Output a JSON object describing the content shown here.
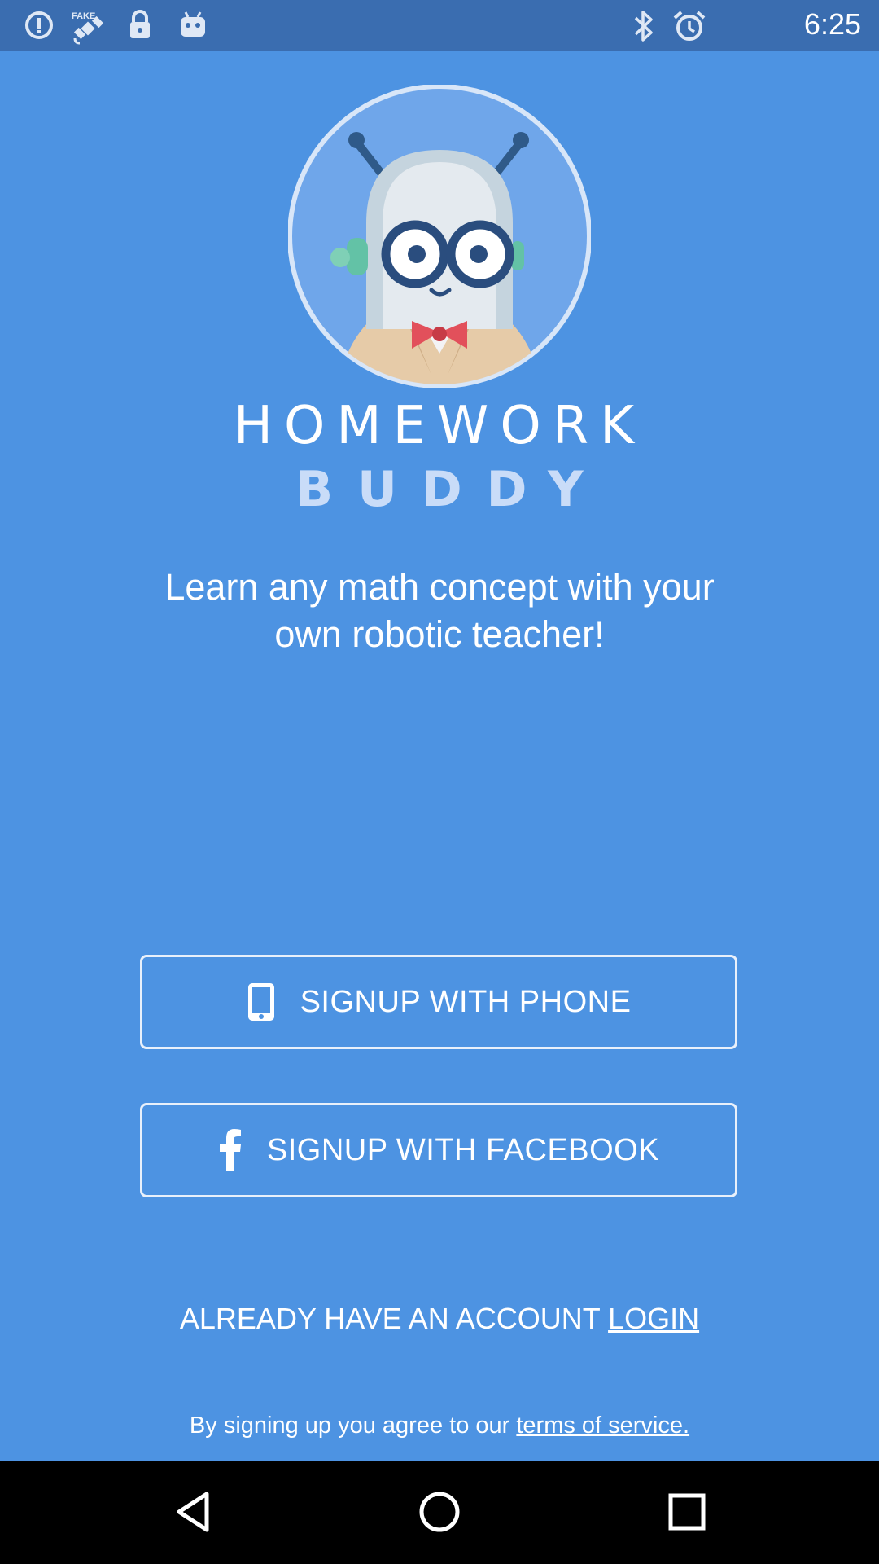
{
  "status_bar": {
    "time": "6:25",
    "icons": [
      "alert-circle-icon",
      "fake-gps-satellite-icon",
      "lock-icon",
      "android-icon",
      "bluetooth-icon",
      "alarm-icon"
    ]
  },
  "logo": {
    "line1": "HOMEWORK",
    "line2": "BUDDY"
  },
  "tagline": "Learn any math concept with your own robotic teacher!",
  "buttons": {
    "phone": {
      "label": "SIGNUP WITH PHONE",
      "icon": "phone-icon"
    },
    "facebook": {
      "label": "SIGNUP WITH FACEBOOK",
      "icon": "facebook-icon"
    }
  },
  "account": {
    "text": "ALREADY HAVE AN ACCOUNT ",
    "link": "LOGIN"
  },
  "terms": {
    "text": "By signing up you agree to our ",
    "link": "terms of service."
  },
  "nav": {
    "icons": [
      "back-icon",
      "home-icon",
      "recents-icon"
    ]
  },
  "colors": {
    "background": "#4d93e2",
    "status_bar": "#3a6db0",
    "nav_bar": "#000000",
    "accent_light": "#c9dcf8"
  }
}
